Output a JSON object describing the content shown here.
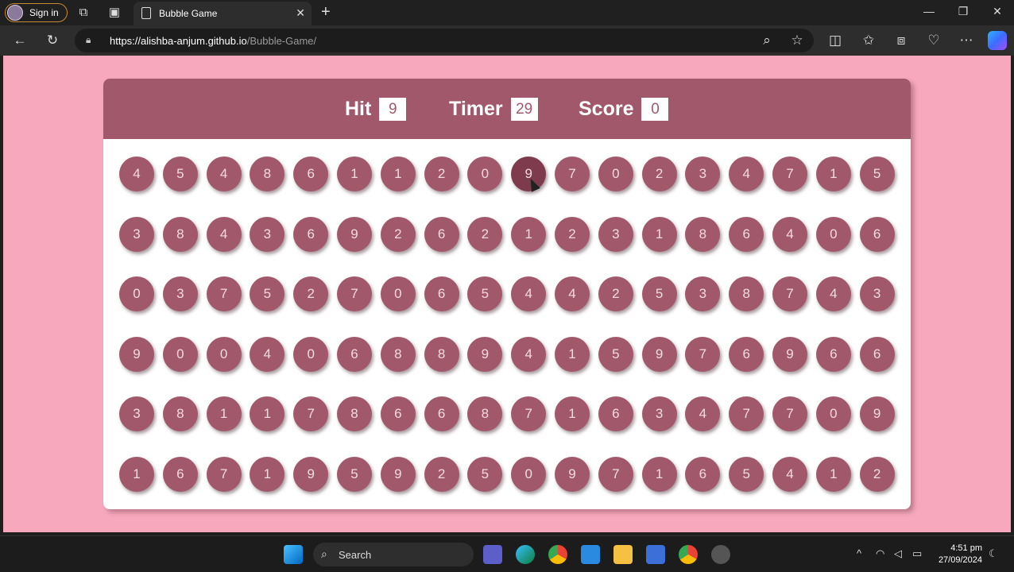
{
  "browser": {
    "signin_label": "Sign in",
    "tab_title": "Bubble Game",
    "url_host": "https://alishba-anjum.github.io",
    "url_path": "/Bubble-Game/"
  },
  "game": {
    "hit_label": "Hit",
    "hit_value": "9",
    "timer_label": "Timer",
    "timer_value": "29",
    "score_label": "Score",
    "score_value": "0",
    "bubbles": [
      [
        "4",
        "5",
        "4",
        "8",
        "6",
        "1",
        "1",
        "2",
        "0",
        "9",
        "7",
        "0",
        "2",
        "3",
        "4",
        "7",
        "1",
        "5"
      ],
      [
        "3",
        "8",
        "4",
        "3",
        "6",
        "9",
        "2",
        "6",
        "2",
        "1",
        "2",
        "3",
        "1",
        "8",
        "6",
        "4",
        "0",
        "6"
      ],
      [
        "0",
        "3",
        "7",
        "5",
        "2",
        "7",
        "0",
        "6",
        "5",
        "4",
        "4",
        "2",
        "5",
        "3",
        "8",
        "7",
        "4",
        "3"
      ],
      [
        "9",
        "0",
        "0",
        "4",
        "0",
        "6",
        "8",
        "8",
        "9",
        "4",
        "1",
        "5",
        "9",
        "7",
        "6",
        "9",
        "6",
        "6"
      ],
      [
        "3",
        "8",
        "1",
        "1",
        "7",
        "8",
        "6",
        "6",
        "8",
        "7",
        "1",
        "6",
        "3",
        "4",
        "7",
        "7",
        "0",
        "9"
      ],
      [
        "1",
        "6",
        "7",
        "1",
        "9",
        "5",
        "9",
        "2",
        "5",
        "0",
        "9",
        "7",
        "1",
        "6",
        "5",
        "4",
        "1",
        "2"
      ]
    ],
    "hovered_bubble": {
      "row": 0,
      "col": 9
    }
  },
  "taskbar": {
    "search_label": "Search",
    "time": "4:51 pm",
    "date": "27/09/2024"
  }
}
